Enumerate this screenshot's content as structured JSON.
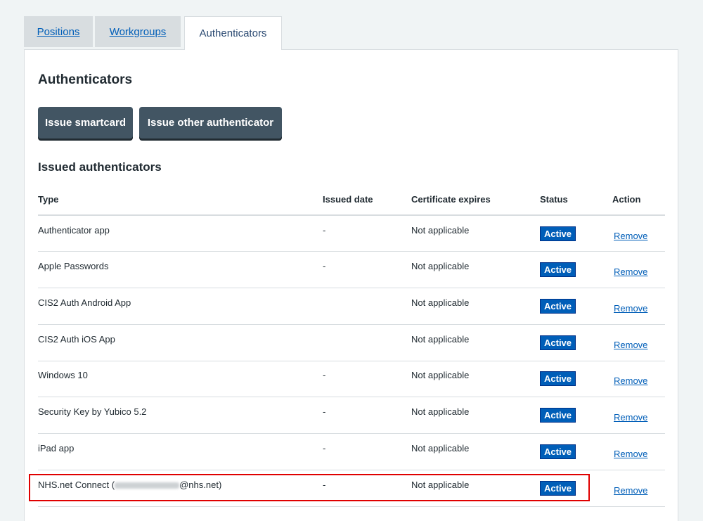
{
  "tabs": [
    {
      "label": "Positions"
    },
    {
      "label": "Workgroups"
    },
    {
      "label": "Authenticators"
    }
  ],
  "heading": "Authenticators",
  "buttons": {
    "issue_smartcard": "Issue smartcard",
    "issue_other": "Issue other authenticator"
  },
  "section_heading": "Issued authenticators",
  "table": {
    "headers": [
      "Type",
      "Issued date",
      "Certificate expires",
      "Status",
      "Action"
    ],
    "rows": [
      {
        "type": "Authenticator app",
        "issued": "-",
        "expires": "Not applicable",
        "status": "Active",
        "action": "Remove"
      },
      {
        "type": "Apple Passwords",
        "issued": "-",
        "expires": "Not applicable",
        "status": "Active",
        "action": "Remove"
      },
      {
        "type": "CIS2 Auth Android App",
        "issued": "",
        "expires": "Not applicable",
        "status": "Active",
        "action": "Remove"
      },
      {
        "type": "CIS2 Auth iOS App",
        "issued": "",
        "expires": "Not applicable",
        "status": "Active",
        "action": "Remove"
      },
      {
        "type": "Windows 10",
        "issued": "-",
        "expires": "Not applicable",
        "status": "Active",
        "action": "Remove"
      },
      {
        "type": "Security Key by Yubico 5.2",
        "issued": "-",
        "expires": "Not applicable",
        "status": "Active",
        "action": "Remove"
      },
      {
        "type": "iPad app",
        "issued": "-",
        "expires": "Not applicable",
        "status": "Active",
        "action": "Remove"
      },
      {
        "type_prefix": "NHS.net Connect (",
        "type_suffix": "@nhs.net)",
        "issued": "-",
        "expires": "Not applicable",
        "status": "Active",
        "action": "Remove"
      }
    ]
  },
  "colors": {
    "nhs_blue": "#005eb8",
    "button_grey": "#425563",
    "highlight_red": "#e00000",
    "background": "#f0f4f5"
  }
}
